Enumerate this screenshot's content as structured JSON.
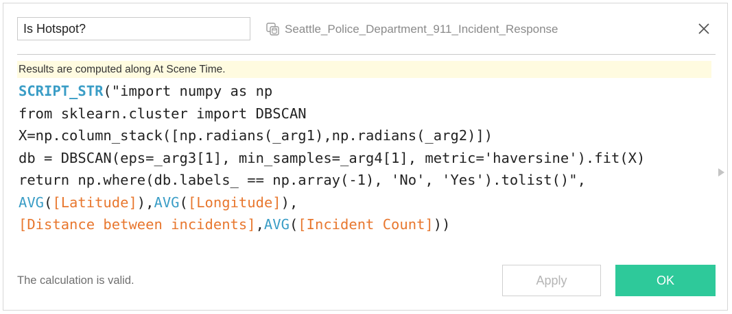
{
  "dialog": {
    "calc_name": "Is Hotspot?",
    "data_source": {
      "icon": "data-source-icon",
      "label": "Seattle_Police_Department_911_Incident_Response"
    },
    "close_icon": "close-icon"
  },
  "info_bar": {
    "text": "Results are computed along At Scene Time."
  },
  "formula": {
    "lines": [
      [
        {
          "type": "script",
          "text": "SCRIPT_STR"
        },
        {
          "type": "plain",
          "text": "(\"import numpy as np"
        }
      ],
      [
        {
          "type": "plain",
          "text": "from sklearn.cluster import DBSCAN"
        }
      ],
      [
        {
          "type": "plain",
          "text": "X=np.column_stack([np.radians(_arg1),np.radians(_arg2)])"
        }
      ],
      [
        {
          "type": "plain",
          "text": "db = DBSCAN(eps=_arg3[1], min_samples=_arg4[1], metric='haversine').fit(X)"
        }
      ],
      [
        {
          "type": "plain",
          "text": "return np.where(db.labels_ == np.array(-1), 'No', 'Yes').tolist()\","
        }
      ],
      [
        {
          "type": "func",
          "text": "AVG"
        },
        {
          "type": "plain",
          "text": "("
        },
        {
          "type": "field",
          "text": "[Latitude]"
        },
        {
          "type": "plain",
          "text": "),"
        },
        {
          "type": "func",
          "text": "AVG"
        },
        {
          "type": "plain",
          "text": "("
        },
        {
          "type": "field",
          "text": "[Longitude]"
        },
        {
          "type": "plain",
          "text": "),"
        }
      ],
      [
        {
          "type": "field",
          "text": "[Distance between incidents]"
        },
        {
          "type": "plain",
          "text": ","
        },
        {
          "type": "func",
          "text": "AVG"
        },
        {
          "type": "plain",
          "text": "("
        },
        {
          "type": "field",
          "text": "[Incident Count]"
        },
        {
          "type": "plain",
          "text": "))"
        }
      ]
    ]
  },
  "footer": {
    "status": "The calculation is valid.",
    "apply_label": "Apply",
    "ok_label": "OK"
  },
  "colors": {
    "script_keyword": "#3a9dc6",
    "function": "#3a9dc6",
    "field": "#e8772e",
    "info_bar_bg": "#fffbe0",
    "ok_button": "#2ec99a"
  }
}
